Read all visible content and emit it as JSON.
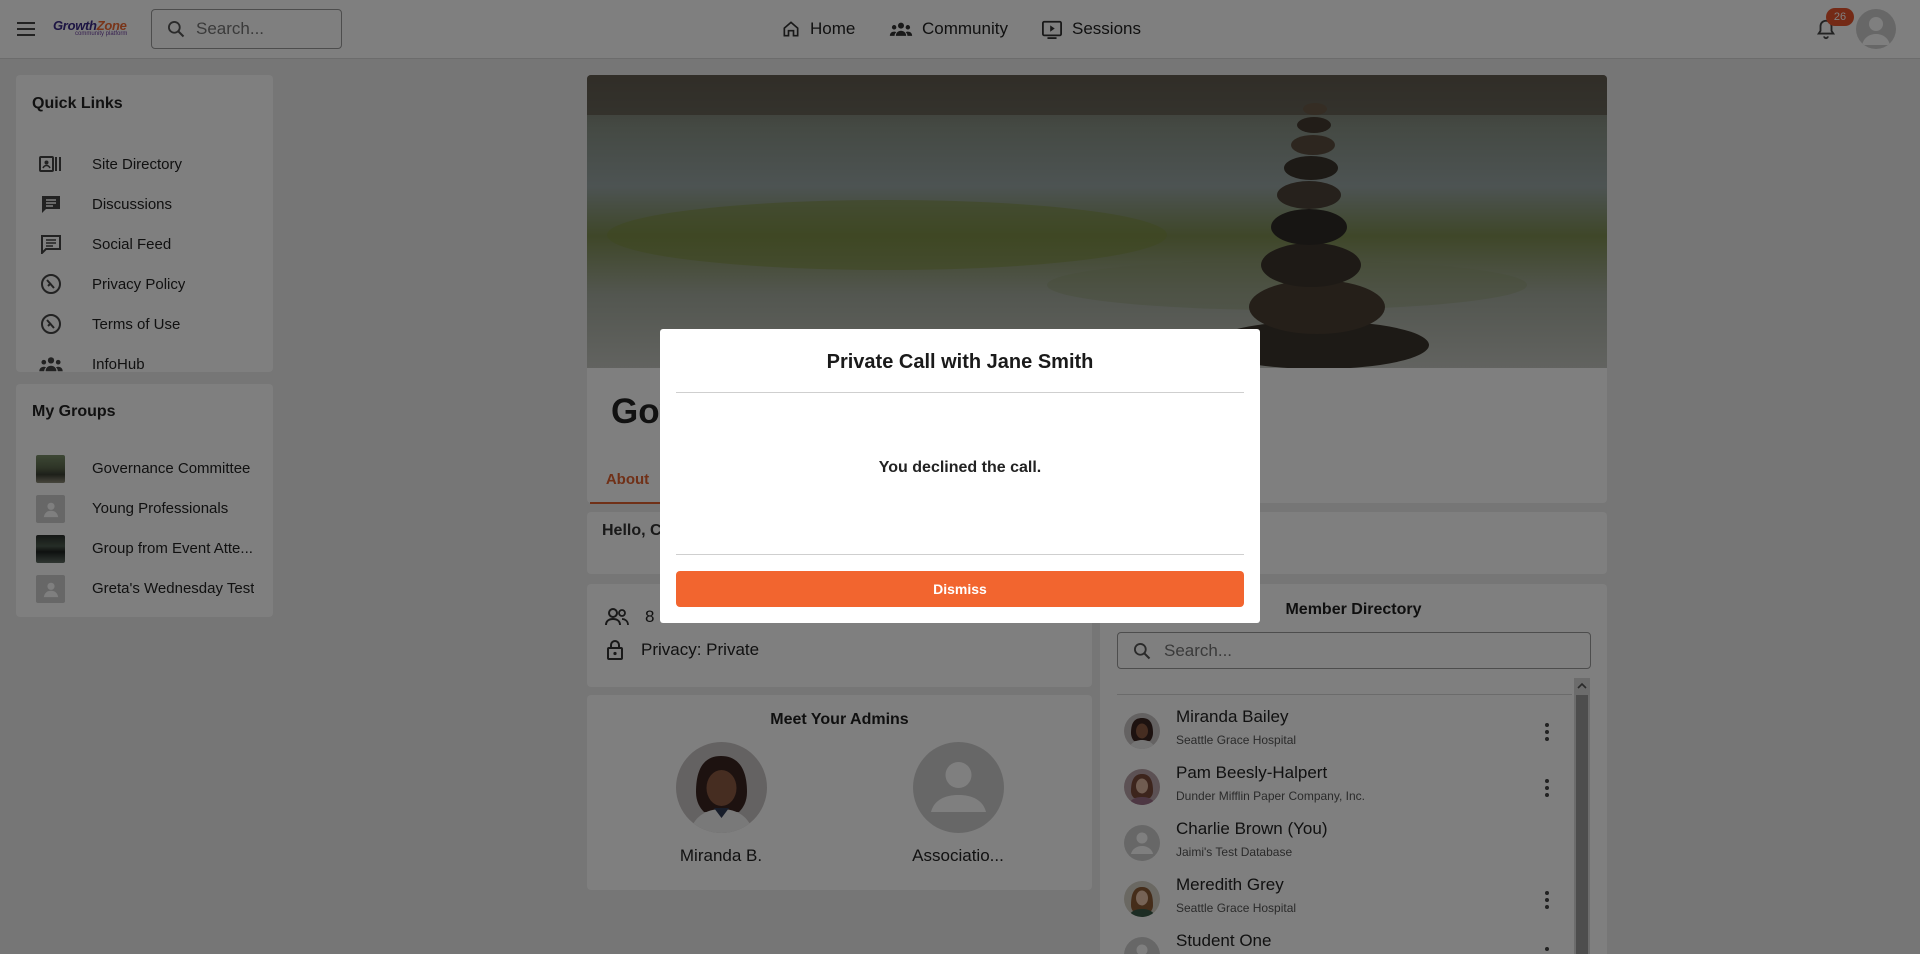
{
  "topbar": {
    "logo_text_a": "Growth",
    "logo_text_b": "Zone",
    "logo_sub": "community platform",
    "search_placeholder": "Search...",
    "nav": [
      {
        "label": "Home",
        "icon": "home-icon"
      },
      {
        "label": "Community",
        "icon": "community-icon"
      },
      {
        "label": "Sessions",
        "icon": "sessions-icon"
      }
    ],
    "notification_count": "26"
  },
  "quick_links": {
    "title": "Quick Links",
    "items": [
      {
        "label": "Site Directory",
        "icon": "directory-icon"
      },
      {
        "label": "Discussions",
        "icon": "chat-icon"
      },
      {
        "label": "Social Feed",
        "icon": "feed-icon"
      },
      {
        "label": "Privacy Policy",
        "icon": "policy-icon"
      },
      {
        "label": "Terms of Use",
        "icon": "terms-icon"
      },
      {
        "label": "InfoHub",
        "icon": "people-icon"
      }
    ]
  },
  "my_groups": {
    "title": "My Groups",
    "items": [
      {
        "label": "Governance Committee"
      },
      {
        "label": "Young Professionals"
      },
      {
        "label": "Group from Event Atte..."
      },
      {
        "label": "Greta's Wednesday Test"
      }
    ]
  },
  "group": {
    "title_partial": "Gov",
    "tab_partial": "About",
    "hello_partial": "Hello, C",
    "members_partial": "8",
    "privacy": "Privacy: Private"
  },
  "admins": {
    "title": "Meet Your Admins",
    "items": [
      {
        "name": "Miranda B."
      },
      {
        "name": "Associatio..."
      }
    ]
  },
  "member_directory": {
    "title": "Member Directory",
    "search_placeholder": "Search...",
    "members": [
      {
        "name": "Miranda Bailey",
        "org": "Seattle Grace Hospital"
      },
      {
        "name": "Pam Beesly-Halpert",
        "org": "Dunder Mifflin Paper Company, Inc."
      },
      {
        "name": "Charlie Brown (You)",
        "org": "Jaimi's Test Database"
      },
      {
        "name": "Meredith Grey",
        "org": "Seattle Grace Hospital"
      },
      {
        "name": "Student One",
        "org": ""
      }
    ]
  },
  "modal": {
    "title": "Private Call with Jane Smith",
    "message": "You declined the call.",
    "button": "Dismiss"
  },
  "colors": {
    "accent": "#f2652f",
    "badge": "#e8542c"
  }
}
